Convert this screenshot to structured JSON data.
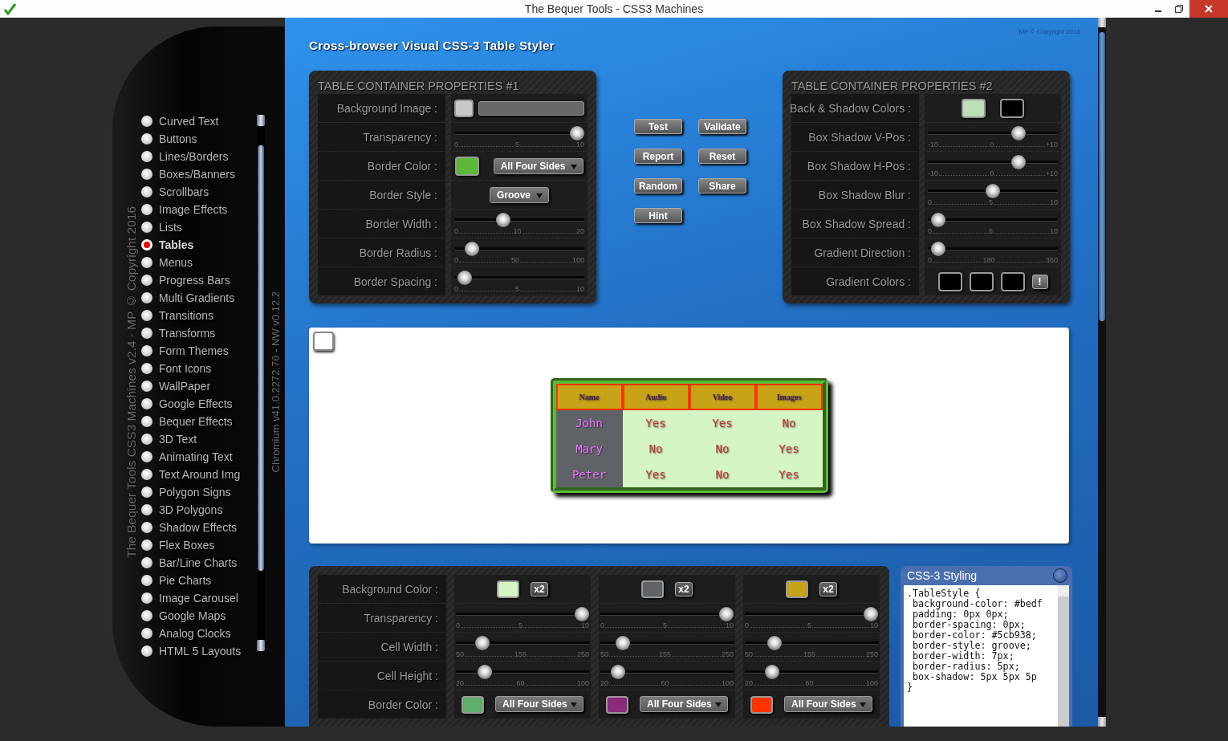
{
  "window": {
    "title": "The Bequer Tools - CSS3 Machines"
  },
  "sidebar": {
    "copyright": "The Bequer Tools CSS3 Machines v2.4 - MP © Copyright 2016",
    "version": "Chromium v41.0.2272.76 - NW v0.12.2",
    "items": [
      {
        "label": "Curved Text",
        "selected": false
      },
      {
        "label": "Buttons",
        "selected": false
      },
      {
        "label": "Lines/Borders",
        "selected": false
      },
      {
        "label": "Boxes/Banners",
        "selected": false
      },
      {
        "label": "Scrollbars",
        "selected": false
      },
      {
        "label": "Image Effects",
        "selected": false
      },
      {
        "label": "Lists",
        "selected": false
      },
      {
        "label": "Tables",
        "selected": true
      },
      {
        "label": "Menus",
        "selected": false
      },
      {
        "label": "Progress Bars",
        "selected": false
      },
      {
        "label": "Multi Gradients",
        "selected": false
      },
      {
        "label": "Transitions",
        "selected": false
      },
      {
        "label": "Transforms",
        "selected": false
      },
      {
        "label": "Form Themes",
        "selected": false
      },
      {
        "label": "Font Icons",
        "selected": false
      },
      {
        "label": "WallPaper",
        "selected": false
      },
      {
        "label": "Google Effects",
        "selected": false
      },
      {
        "label": "Bequer Effects",
        "selected": false
      },
      {
        "label": "3D Text",
        "selected": false
      },
      {
        "label": "Animating Text",
        "selected": false
      },
      {
        "label": "Text Around Img",
        "selected": false
      },
      {
        "label": "Polygon Signs",
        "selected": false
      },
      {
        "label": "3D Polygons",
        "selected": false
      },
      {
        "label": "Shadow Effects",
        "selected": false
      },
      {
        "label": "Flex Boxes",
        "selected": false
      },
      {
        "label": "Bar/Line Charts",
        "selected": false
      },
      {
        "label": "Pie Charts",
        "selected": false
      },
      {
        "label": "Image Carousel",
        "selected": false
      },
      {
        "label": "Google Maps",
        "selected": false
      },
      {
        "label": "Analog Clocks",
        "selected": false
      },
      {
        "label": "HTML 5 Layouts",
        "selected": false
      }
    ]
  },
  "header": {
    "title": "Cross-browser Visual CSS-3 Table Styler",
    "copyright": "MP © Copyright 2016"
  },
  "panels": [
    {
      "title": "TABLE CONTAINER PROPERTIES #1",
      "rows": [
        {
          "kind": "image",
          "label": "Background Image :",
          "color": "#c8c8c8"
        },
        {
          "kind": "slider",
          "label": "Transparency :",
          "level": 1,
          "ticks": [
            "0",
            "5",
            "10"
          ]
        },
        {
          "kind": "color-select",
          "label": "Border Color :",
          "color": "#5cb938",
          "value": "All Four Sides"
        },
        {
          "kind": "select",
          "label": "Border Style :",
          "value": "Groove"
        },
        {
          "kind": "slider",
          "label": "Border Width :",
          "level": 0.36,
          "ticks": [
            "0",
            "10",
            "20"
          ]
        },
        {
          "kind": "slider",
          "label": "Border Radius :",
          "level": 0.09,
          "ticks": [
            "0",
            "50",
            "100"
          ]
        },
        {
          "kind": "slider",
          "label": "Border Spacing :",
          "level": 0.03,
          "ticks": [
            "0",
            "5",
            "10"
          ]
        }
      ]
    },
    {
      "title": "TABLE CONTAINER PROPERTIES #2",
      "rows": [
        {
          "kind": "swatches",
          "label": "Back & Shadow Colors :",
          "swatches": [
            {
              "color": "#bedfb8"
            },
            {
              "color": "#000000"
            }
          ]
        },
        {
          "kind": "slider",
          "label": "Box Shadow V-Pos :",
          "level": 0.72,
          "ticks": [
            "-10",
            "0",
            "+10"
          ]
        },
        {
          "kind": "slider",
          "label": "Box Shadow H-Pos :",
          "level": 0.72,
          "ticks": [
            "-10",
            "0",
            "+10"
          ]
        },
        {
          "kind": "slider",
          "label": "Box Shadow Blur :",
          "level": 0.5,
          "ticks": [
            "0",
            "5",
            "10"
          ]
        },
        {
          "kind": "slider",
          "label": "Box Shadow Spread :",
          "level": 0.03,
          "ticks": [
            "0",
            "5",
            "10"
          ]
        },
        {
          "kind": "slider",
          "label": "Gradient Direction :",
          "level": 0.03,
          "ticks": [
            "0",
            "180",
            "360"
          ]
        },
        {
          "kind": "swatches",
          "label": "Gradient Colors :",
          "swatches": [
            {
              "color": "#000000"
            },
            {
              "color": "#000000"
            },
            {
              "color": "#000000"
            }
          ],
          "button": "!"
        }
      ]
    }
  ],
  "actions": [
    "Test",
    "Validate",
    "Report",
    "Reset",
    "Random",
    "Share",
    "Hint"
  ],
  "preview": {
    "checked": false,
    "columns": [
      "Name",
      "Audio",
      "Video",
      "Images"
    ],
    "rows": [
      [
        "John",
        "Yes",
        "Yes",
        "No"
      ],
      [
        "Mary",
        "No",
        "No",
        "Yes"
      ],
      [
        "Peter",
        "Yes",
        "No",
        "Yes"
      ]
    ]
  },
  "cell_panel": {
    "rows": [
      {
        "kind": "colors",
        "label": "Background Color :",
        "cells": [
          {
            "color": "#d5f5c5",
            "button": "x2"
          },
          {
            "color": "#5f6266",
            "button": "x2"
          },
          {
            "color": "#c7a317",
            "button": "x2"
          }
        ]
      },
      {
        "kind": "sliders",
        "label": "Transparency :",
        "cells": [
          {
            "level": 1,
            "ticks": [
              "0",
              "5",
              "10"
            ]
          },
          {
            "level": 1,
            "ticks": [
              "0",
              "5",
              "10"
            ]
          },
          {
            "level": 1,
            "ticks": [
              "0",
              "5",
              "10"
            ]
          }
        ]
      },
      {
        "kind": "sliders",
        "label": "Cell Width :",
        "cells": [
          {
            "level": 0.16,
            "ticks": [
              "50",
              "155",
              "250"
            ]
          },
          {
            "level": 0.13,
            "ticks": [
              "50",
              "155",
              "250"
            ]
          },
          {
            "level": 0.19,
            "ticks": [
              "50",
              "155",
              "250"
            ]
          }
        ]
      },
      {
        "kind": "sliders",
        "label": "Cell Height :",
        "cells": [
          {
            "level": 0.18,
            "ticks": [
              "20",
              "60",
              "100"
            ]
          },
          {
            "level": 0.09,
            "ticks": [
              "20",
              "60",
              "100"
            ]
          },
          {
            "level": 0.17,
            "ticks": [
              "20",
              "60",
              "100"
            ]
          }
        ]
      },
      {
        "kind": "color-selects",
        "label": "Border Color :",
        "cells": [
          {
            "color": "#5fae6a",
            "value": "All Four Sides"
          },
          {
            "color": "#8b2a7a",
            "value": "All Four Sides"
          },
          {
            "color": "#ff3300",
            "value": "All Four Sides"
          }
        ]
      }
    ]
  },
  "css_box": {
    "title": "CSS-3 Styling",
    "code": ".TableStyle {\n background-color: #bedf\n padding: 0px 0px;\n border-spacing: 0px;\n border-color: #5cb938;\n border-style: groove;\n border-width: 7px;\n border-radius: 5px;\n box-shadow: 5px 5px 5p\n}"
  }
}
